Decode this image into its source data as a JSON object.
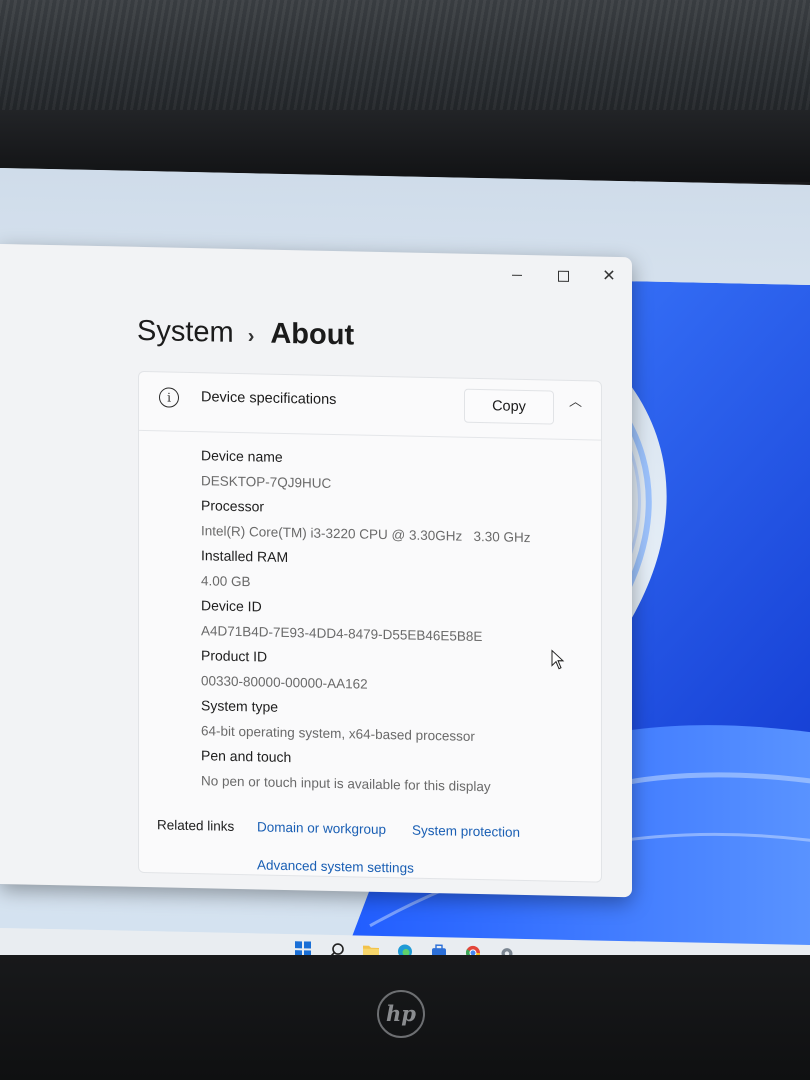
{
  "window": {
    "breadcrumb": {
      "parent": "System",
      "separator": "›",
      "current": "About"
    },
    "controls": [
      "minimize-icon",
      "maximize-icon",
      "close-icon"
    ]
  },
  "device_specs": {
    "title": "Device specifications",
    "copy_label": "Copy",
    "items": [
      {
        "label": "Device name",
        "value": "DESKTOP-7QJ9HUC"
      },
      {
        "label": "Processor",
        "value": "Intel(R) Core(TM) i3-3220 CPU @ 3.30GHz   3.30 GHz"
      },
      {
        "label": "Installed RAM",
        "value": "4.00 GB"
      },
      {
        "label": "Device ID",
        "value": "A4D71B4D-7E93-4DD4-8479-D55EB46E5B8E"
      },
      {
        "label": "Product ID",
        "value": "00330-80000-00000-AA162"
      },
      {
        "label": "System type",
        "value": "64-bit operating system, x64-based processor"
      },
      {
        "label": "Pen and touch",
        "value": "No pen or touch input is available for this display"
      }
    ]
  },
  "related_links": {
    "label": "Related links",
    "links": [
      "Domain or workgroup",
      "System protection",
      "Advanced system settings"
    ]
  },
  "taskbar": {
    "icons": [
      "windows-start-icon",
      "search-icon",
      "file-explorer-icon",
      "edge-icon",
      "store-icon",
      "chrome-icon",
      "settings-icon"
    ]
  },
  "brand": "hp",
  "colors": {
    "accent": "#1a5fb4",
    "wallpaper_blue": "#1f5bff"
  }
}
